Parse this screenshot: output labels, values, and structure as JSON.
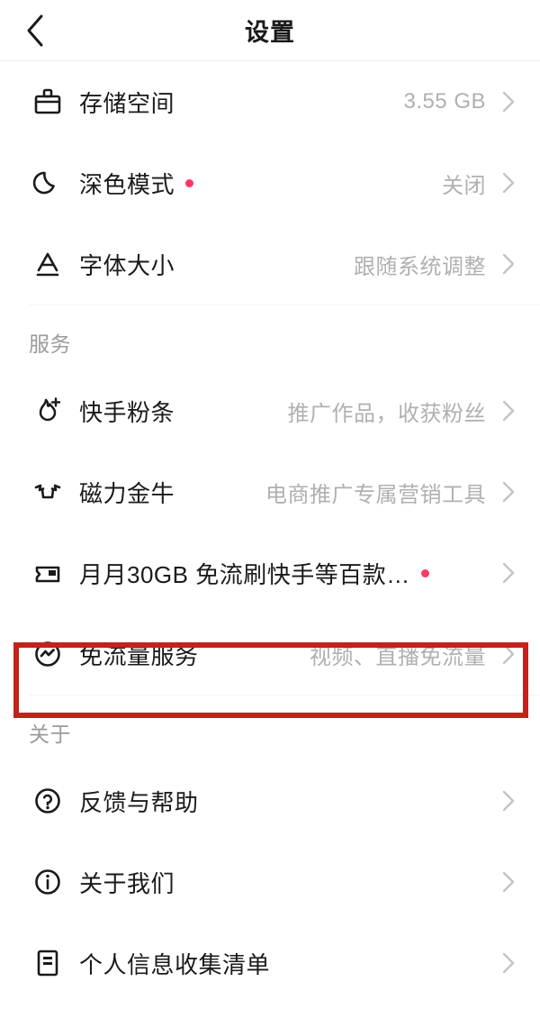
{
  "header": {
    "title": "设置",
    "back_icon": "chevron-left-icon"
  },
  "sections": [
    {
      "id": "general",
      "title": "",
      "items": [
        {
          "id": "storage",
          "icon": "storage-bucket-icon",
          "label": "存储空间",
          "value": "3.55 GB",
          "badge": false,
          "chevron": true
        },
        {
          "id": "dark-mode",
          "icon": "moon-icon",
          "label": "深色模式",
          "value": "关闭",
          "badge": true,
          "chevron": true
        },
        {
          "id": "font-size",
          "icon": "font-size-a-icon",
          "label": "字体大小",
          "value": "跟随系统调整",
          "badge": false,
          "chevron": true
        }
      ]
    },
    {
      "id": "services",
      "title": "服务",
      "items": [
        {
          "id": "kuaishou-fentiao",
          "icon": "flame-plus-icon",
          "label": "快手粉条",
          "value": "推广作品，收获粉丝",
          "badge": false,
          "chevron": true
        },
        {
          "id": "cili-jinniu",
          "icon": "bull-head-icon",
          "label": "磁力金牛",
          "value": "电商推广专属营销工具",
          "badge": false,
          "chevron": true
        },
        {
          "id": "monthly-data",
          "icon": "sim-card-icon",
          "label": "月月30GB 免流刷快手等百款…",
          "value": "",
          "badge": true,
          "chevron": true
        },
        {
          "id": "free-data-service",
          "icon": "lightning-circle-icon",
          "label": "免流量服务",
          "value": "视频、直播免流量",
          "badge": false,
          "chevron": true,
          "highlighted": true
        }
      ]
    },
    {
      "id": "about",
      "title": "关于",
      "items": [
        {
          "id": "feedback-help",
          "icon": "question-circle-icon",
          "label": "反馈与帮助",
          "value": "",
          "badge": false,
          "chevron": true
        },
        {
          "id": "about-us",
          "icon": "info-circle-icon",
          "label": "关于我们",
          "value": "",
          "badge": false,
          "chevron": true
        },
        {
          "id": "personal-info-list",
          "icon": "document-list-icon",
          "label": "个人信息收集清单",
          "value": "",
          "badge": false,
          "chevron": true
        }
      ]
    }
  ],
  "colors": {
    "badge": "#FE3666",
    "highlight": "#C4221A",
    "text_primary": "#1a1a1a",
    "text_secondary": "#b0b0b0"
  },
  "annotation": {
    "type": "highlight-rectangle",
    "target": "免流量服务"
  }
}
